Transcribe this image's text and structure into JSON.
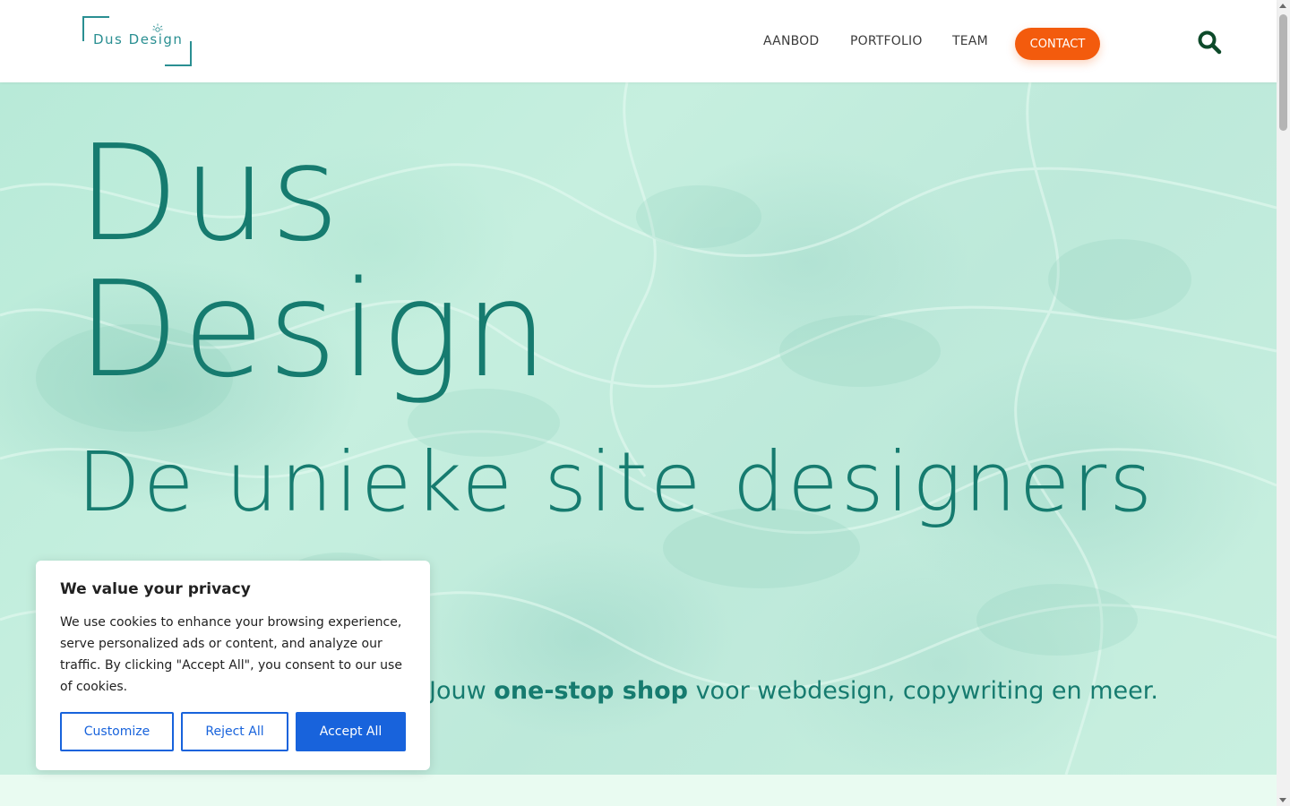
{
  "header": {
    "logo_text": "Dus Design",
    "nav": [
      {
        "label": "AANBOD"
      },
      {
        "label": "PORTFOLIO"
      },
      {
        "label": "TEAM"
      }
    ],
    "contact_label": "CONTACT",
    "search_icon": "search-icon"
  },
  "hero": {
    "title_line1": "Dus",
    "title_line2": "Design",
    "subtitle": "De unieke site designers",
    "tagline_prefix": "Jouw ",
    "tagline_bold": "one-stop shop",
    "tagline_suffix": " voor webdesign, copywriting en meer."
  },
  "cookie": {
    "title": "We value your privacy",
    "text": "We use cookies to enhance your browsing experience, serve personalized ads or content, and analyze our traffic. By clicking \"Accept All\", you consent to our use of cookies.",
    "customize_label": "Customize",
    "reject_label": "Reject All",
    "accept_label": "Accept All"
  },
  "colors": {
    "brand_teal": "#167b6f",
    "contact_orange": "#f35b0d",
    "cookie_blue": "#1863dc",
    "search_green": "#0d4a2a"
  }
}
